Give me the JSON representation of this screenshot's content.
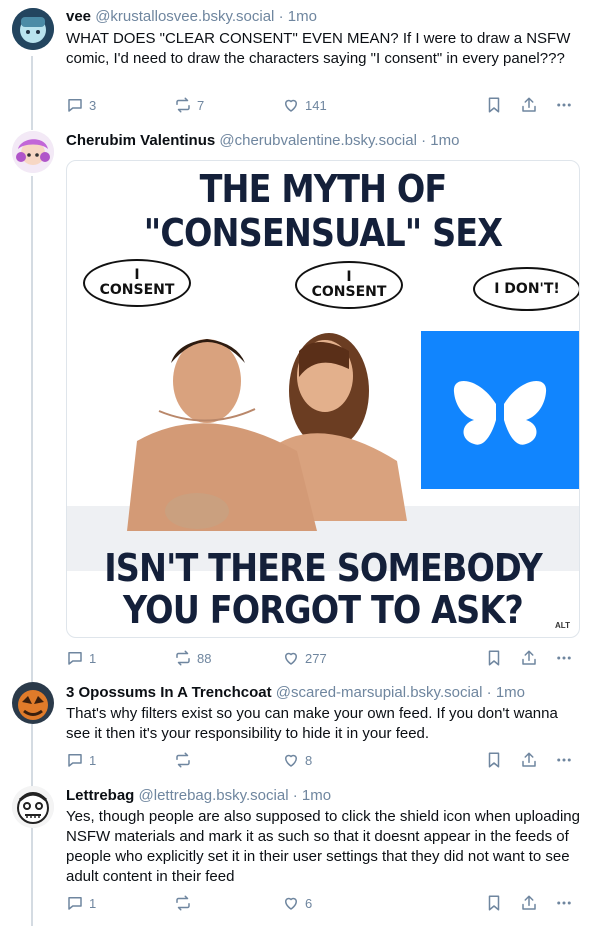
{
  "posts": [
    {
      "author": "vee",
      "handle": "@krustallosvee.bsky.social",
      "separator": "·",
      "time": "1mo",
      "text": "WHAT DOES \"CLEAR CONSENT\" EVEN MEAN? If I were to draw a NSFW comic, I'd need to draw the characters saying \"I consent\" in every panel???",
      "replies": "3",
      "reposts": "7",
      "likes": "141"
    },
    {
      "author": "Cherubim Valentinus",
      "handle": "@cherubvalentine.bsky.social",
      "separator": "·",
      "time": "1mo",
      "replies": "1",
      "reposts": "88",
      "likes": "277",
      "image": {
        "title_line1": "THE MYTH OF",
        "title_line2": "\"CONSENSUAL\" SEX",
        "bubble_left": "I\nCONSENT",
        "bubble_mid": "I\nCONSENT",
        "bubble_right": "I DON'T!",
        "bottom_line1": "ISN'T THERE SOMEBODY",
        "bottom_line2": "YOU FORGOT TO ASK?",
        "alt_badge": "ALT",
        "butterfly_color": "#1185fe"
      }
    },
    {
      "author": "3 Opossums In A Trenchcoat",
      "handle": "@scared-marsupial.bsky.social",
      "separator": "·",
      "time": "1mo",
      "text": "That's why filters exist so you can make your own feed. If you don't wanna see it then it's your responsibility to hide it in your feed.",
      "replies": "1",
      "reposts": "",
      "likes": "8"
    },
    {
      "author": "Lettrebag",
      "handle": "@lettrebag.bsky.social",
      "separator": "·",
      "time": "1mo",
      "text": "Yes, though people are also supposed to click the shield icon when uploading NSFW materials and mark it as such so that it doesnt appear in the feeds of people who explicitly set it in their user settings that they did not want to see adult content in their feed",
      "replies": "1",
      "reposts": "",
      "likes": "6"
    }
  ],
  "icons": [
    "reply-icon",
    "repost-icon",
    "like-icon",
    "bookmark-icon",
    "share-icon",
    "more-icon"
  ],
  "colors": {
    "muted": "#6f869f",
    "text": "#0b0f14",
    "thread_line": "#d4dbe2"
  }
}
